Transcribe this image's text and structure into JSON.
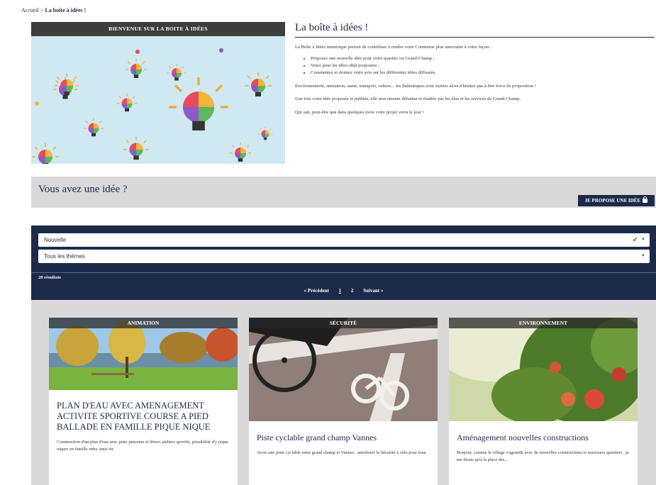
{
  "breadcrumb": {
    "home": "Accueil",
    "separator": ">",
    "current": "La boîte à idées !"
  },
  "hero": {
    "title": "BIENVENUE SUR LA BOITE À IDÉES"
  },
  "intro": {
    "title": "La boîte à idées !",
    "lead": "La Boîte à Idées numérique permet de contribuer à rendre votre Commune plus innovante à votre façon :",
    "bullets": [
      "Proposez une nouvelle idée pour votre quartier ou Grand-Champ ;",
      "Votez pour les idées déjà proposées ;",
      "Commentez et donnez votre avis sur les différentes idées diffusées."
    ],
    "p2": "Environnement, animation, santé, transport, culture... les thématiques sont variées alors n'hésitez pas à être force de proposition !",
    "p3": "Une fois votre idée proposée et publiée, elle sera ensuite débattue et étudiée par les élus et les services de Grand-Champ.",
    "p4": "Qui sait, peut-être que dans quelques mois votre projet verra le jour !"
  },
  "idea": {
    "question": "Vous avez une idée ?",
    "button": "JE PROPOSE UNE IDÉE"
  },
  "filters": {
    "status": "Nouvelle",
    "theme": "Tous les thèmes",
    "results": "20 résultats",
    "prev": "« Précédent",
    "pages": [
      "1",
      "2"
    ],
    "next": "Suivant »"
  },
  "cards": [
    {
      "category": "ANIMATION",
      "title": "PLAN D'EAU AVEC AMENAGEMENT ACTIVITE SPORTIVE COURSE A PIED BALLADE EN FAMILLE PIQUE NIQUE",
      "text": "Construction d'un plan d'eau avec piste pietonne et divers ateliers sportifs, possibilité d'y pique niquer en famille entre amis etc"
    },
    {
      "category": "SÉCURITÉ",
      "title": "Piste cyclable grand champ Vannes",
      "text": "Avoir une piste cyclable entre grand champ et Vannes. -ameliorer la Sécurité à vélo pour tous."
    },
    {
      "category": "ENVIRONNEMENT",
      "title": "Aménagement nouvelles constructions",
      "text": "Bonjour, comme le village s'agrandit avec de nouvelles constructions et nouveaux quartiers , je me disais qu'à la place des..."
    }
  ],
  "colors": {
    "navy": "#1c2a4a",
    "grey_panel": "#d9d9d9",
    "check": "#3a9b3a"
  }
}
